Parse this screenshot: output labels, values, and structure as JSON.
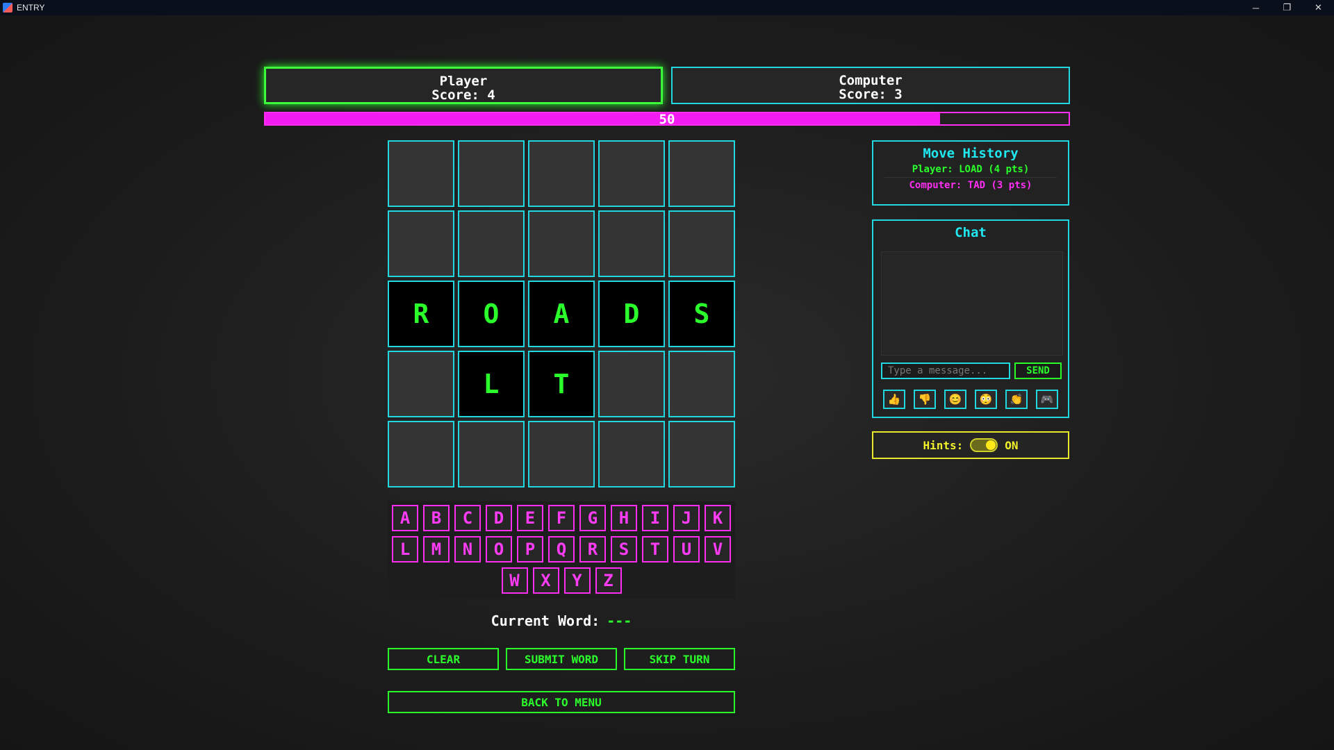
{
  "window": {
    "title": "ENTRY",
    "controls": {
      "minimize": "─",
      "restore": "❐",
      "close": "✕"
    }
  },
  "scoreboard": {
    "player": {
      "name": "Player",
      "score": "Score: 4",
      "active": true
    },
    "computer": {
      "name": "Computer",
      "score": "Score: 3",
      "active": false
    }
  },
  "timer": {
    "label": "50",
    "fraction": 0.84
  },
  "grid": {
    "rows": [
      [
        "",
        "",
        "",
        "",
        ""
      ],
      [
        "",
        "",
        "",
        "",
        ""
      ],
      [
        "R",
        "O",
        "A",
        "D",
        "S"
      ],
      [
        "",
        "L",
        "T",
        "",
        ""
      ],
      [
        "",
        "",
        "",
        "",
        ""
      ]
    ]
  },
  "keyboard": {
    "rows": [
      [
        "A",
        "B",
        "C",
        "D",
        "E",
        "F",
        "G",
        "H",
        "I",
        "J",
        "K"
      ],
      [
        "L",
        "M",
        "N",
        "O",
        "P",
        "Q",
        "R",
        "S",
        "T",
        "U",
        "V"
      ],
      [
        "W",
        "X",
        "Y",
        "Z"
      ]
    ]
  },
  "current_word": {
    "label": "Current Word:",
    "value": "---"
  },
  "buttons": {
    "clear": "CLEAR",
    "submit": "SUBMIT WORD",
    "skip": "SKIP TURN",
    "back": "BACK TO MENU"
  },
  "move_history": {
    "title": "Move History",
    "entries": [
      {
        "text": "Player: LOAD (4 pts)",
        "color": "#2bff2b"
      },
      {
        "text": "Computer: TAD (3 pts)",
        "color": "#ff2ef2"
      }
    ]
  },
  "chat": {
    "title": "Chat",
    "input_placeholder": "Type a message...",
    "send_label": "SEND",
    "emojis": [
      {
        "icon": "thumbs-up-icon",
        "glyph": "👍"
      },
      {
        "icon": "thumbs-down-icon",
        "glyph": "👎"
      },
      {
        "icon": "smile-icon",
        "glyph": "😊"
      },
      {
        "icon": "flushed-icon",
        "glyph": "😳"
      },
      {
        "icon": "clap-icon",
        "glyph": "👏"
      },
      {
        "icon": "game-controller-icon",
        "glyph": "🎮"
      }
    ]
  },
  "hints": {
    "label": "Hints:",
    "state": "ON",
    "enabled": true
  },
  "colors": {
    "neon_green": "#2bff2b",
    "neon_cyan": "#20d8e0",
    "neon_magenta": "#ff2ef2",
    "neon_yellow": "#f2f22c"
  }
}
